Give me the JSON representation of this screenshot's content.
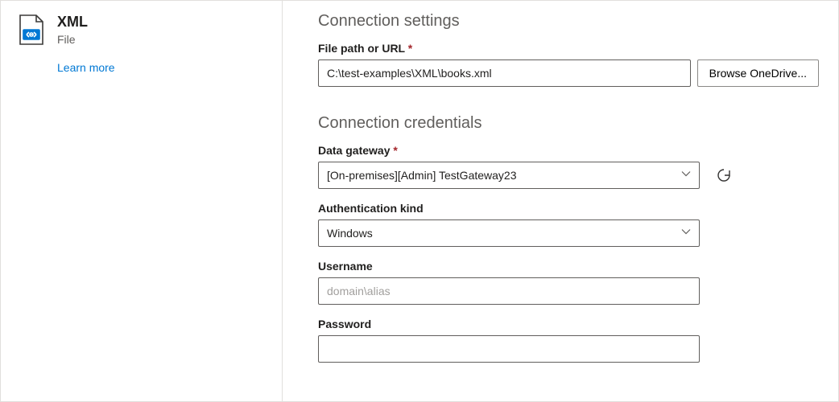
{
  "sidebar": {
    "title": "XML",
    "subtitle": "File",
    "learn_more": "Learn more"
  },
  "settings": {
    "heading": "Connection settings",
    "file_path": {
      "label": "File path or URL",
      "required": "*",
      "value": "C:\\test-examples\\XML\\books.xml"
    },
    "browse_label": "Browse OneDrive..."
  },
  "credentials": {
    "heading": "Connection credentials",
    "gateway": {
      "label": "Data gateway",
      "required": "*",
      "value": "[On-premises][Admin] TestGateway23"
    },
    "auth": {
      "label": "Authentication kind",
      "value": "Windows"
    },
    "username": {
      "label": "Username",
      "placeholder": "domain\\alias"
    },
    "password": {
      "label": "Password"
    }
  }
}
